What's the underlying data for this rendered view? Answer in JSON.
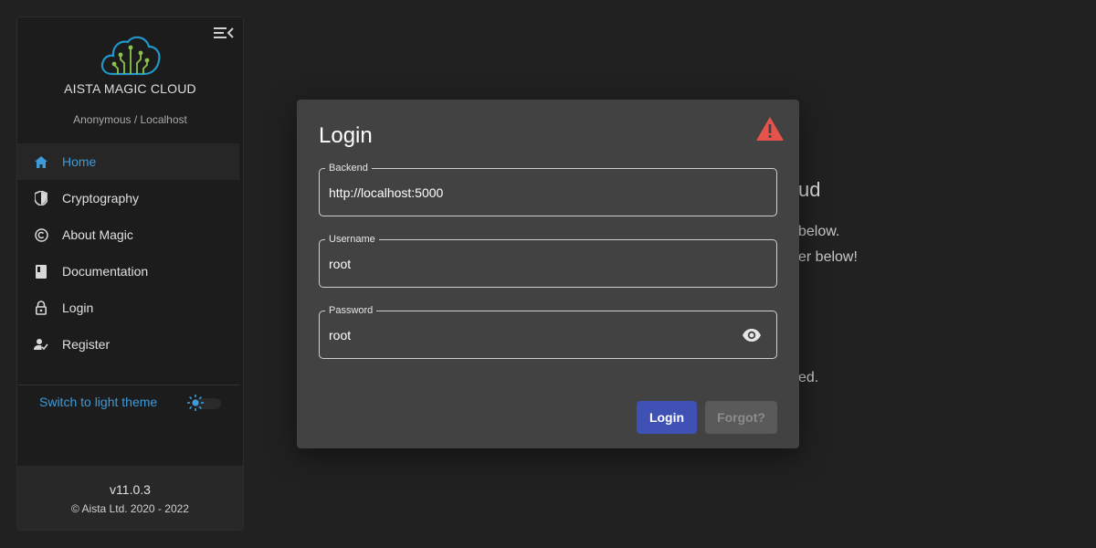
{
  "sidebar": {
    "app_name": "AISTA MAGIC CLOUD",
    "user_line": "Anonymous / Localhost",
    "items": [
      {
        "label": "Home",
        "icon": "home-icon",
        "active": true
      },
      {
        "label": "Cryptography",
        "icon": "shield-icon",
        "active": false
      },
      {
        "label": "About Magic",
        "icon": "copyright-icon",
        "active": false
      },
      {
        "label": "Documentation",
        "icon": "book-icon",
        "active": false
      },
      {
        "label": "Login",
        "icon": "lock-icon",
        "active": false
      },
      {
        "label": "Register",
        "icon": "person-check-icon",
        "active": false
      }
    ],
    "theme_switch_label": "Switch to light theme",
    "footer": {
      "version": "v11.0.3",
      "copyright": "© Aista Ltd. 2020 - 2022"
    }
  },
  "background": {
    "heading_fragment": "ud",
    "line1_fragment": "below.",
    "line2_fragment": "er below!",
    "line3_fragment": "ed."
  },
  "dialog": {
    "title": "Login",
    "fields": {
      "backend": {
        "label": "Backend",
        "value": "http://localhost:5000"
      },
      "username": {
        "label": "Username",
        "value": "root"
      },
      "password": {
        "label": "Password",
        "value": "root"
      }
    },
    "login_button": "Login",
    "forgot_button": "Forgot?"
  },
  "colors": {
    "accent": "#3d9bd9",
    "primary_button": "#3f51b5",
    "warning": "#e5534b",
    "logo_cloud": "#2196c9",
    "logo_circuit": "#8bc34a"
  }
}
